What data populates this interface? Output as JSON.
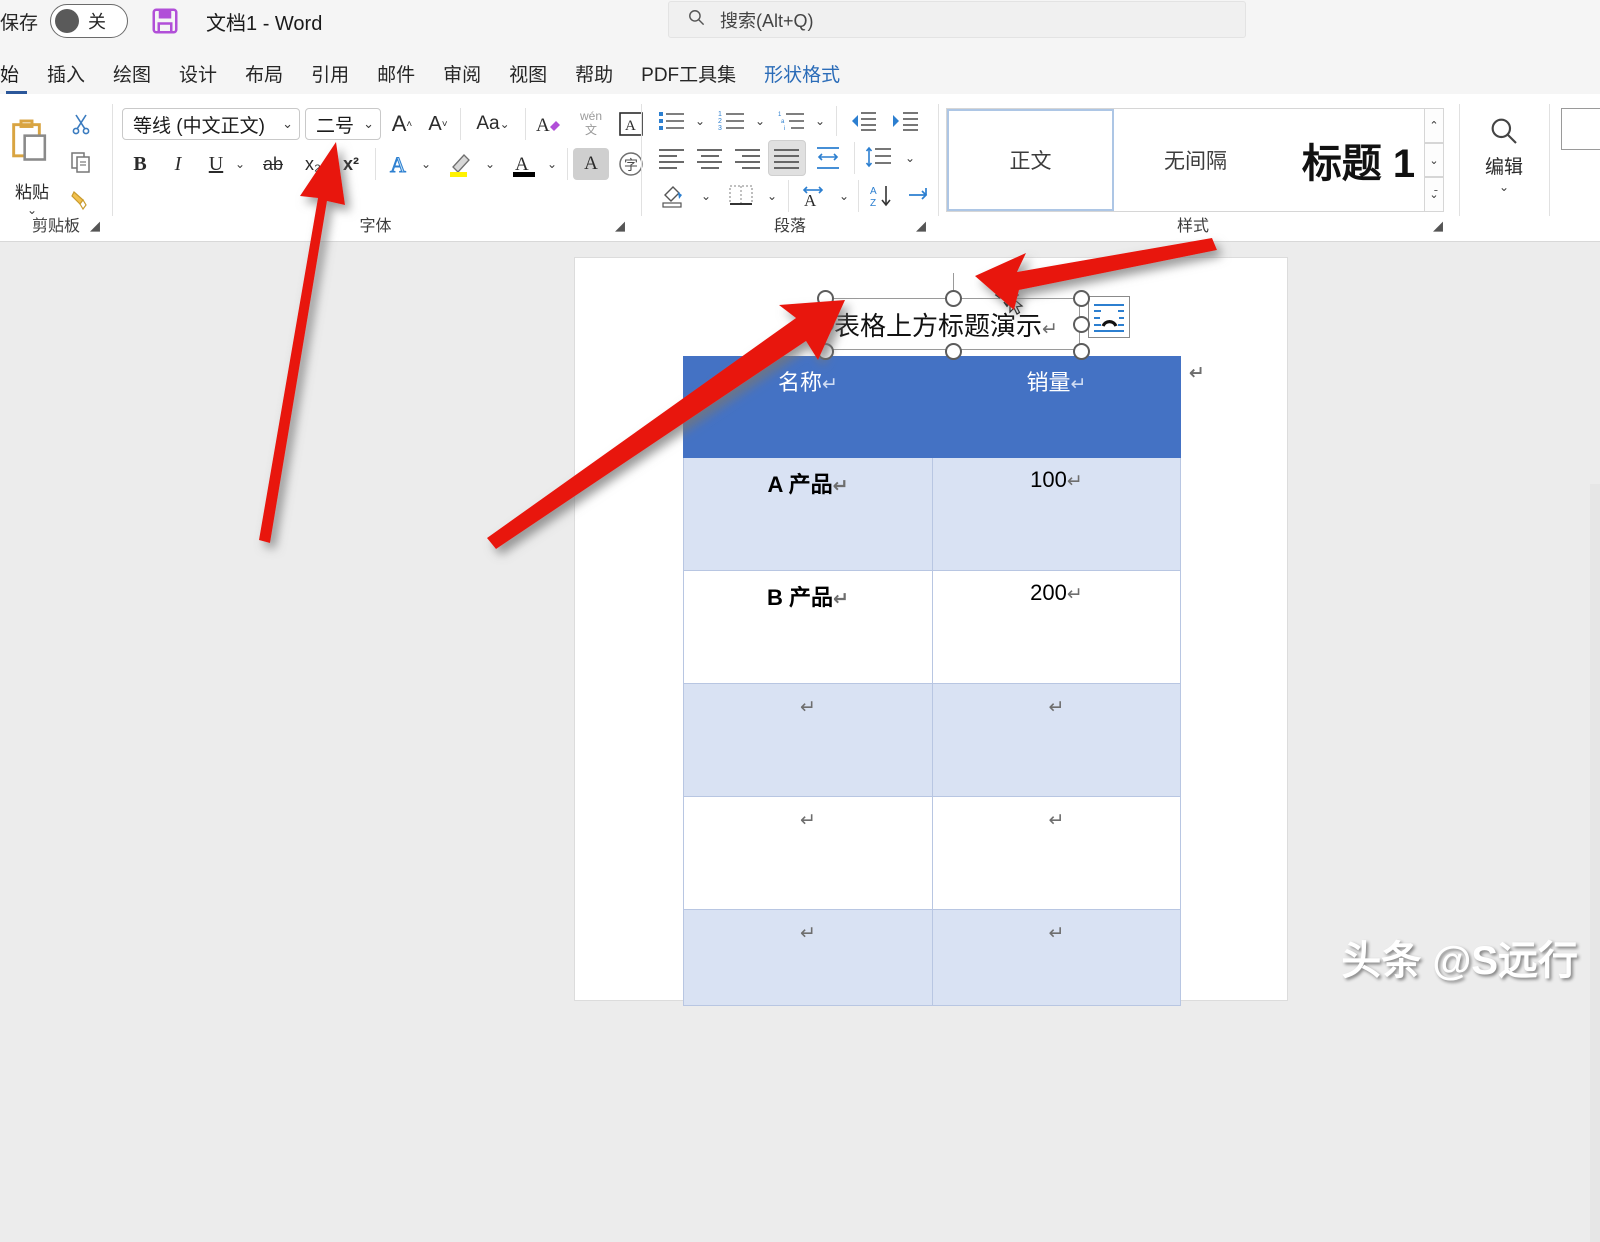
{
  "titlebar": {
    "autosave_label": "保存",
    "autosave_state": "关",
    "save_icon": "floppy-disk-icon",
    "document_title": "文档1  -  Word",
    "search_icon": "search-icon",
    "search_placeholder": "搜索(Alt+Q)"
  },
  "tabs": [
    {
      "label": "始",
      "state": "active"
    },
    {
      "label": "插入",
      "state": "normal"
    },
    {
      "label": "绘图",
      "state": "normal"
    },
    {
      "label": "设计",
      "state": "normal"
    },
    {
      "label": "布局",
      "state": "normal"
    },
    {
      "label": "引用",
      "state": "normal"
    },
    {
      "label": "邮件",
      "state": "normal"
    },
    {
      "label": "审阅",
      "state": "normal"
    },
    {
      "label": "视图",
      "state": "normal"
    },
    {
      "label": "帮助",
      "state": "normal"
    },
    {
      "label": "PDF工具集",
      "state": "normal"
    },
    {
      "label": "形状格式",
      "state": "contextual"
    }
  ],
  "ribbon": {
    "clipboard": {
      "label": "剪贴板",
      "paste_label": "粘贴",
      "paste_icon": "clipboard-icon",
      "cut_icon": "scissors-icon",
      "copy_icon": "copy-icon",
      "format_painter_icon": "format-painter-icon",
      "launcher_icon": "dialog-launcher-icon"
    },
    "font": {
      "label": "字体",
      "font_name": "等线 (中文正文)",
      "font_size": "二号",
      "grow_font_icon": "grow-font-icon",
      "shrink_font_icon": "shrink-font-icon",
      "change_case_icon": "change-case-icon",
      "clear_formatting_icon": "clear-formatting-icon",
      "phonetic_guide_icon": "phonetic-guide-icon",
      "character_border_icon": "character-border-icon",
      "bold_label": "B",
      "italic_label": "I",
      "underline_label": "U",
      "strikethrough_label": "ab",
      "subscript_label": "x₂",
      "superscript_label": "x²",
      "text_effects_icon": "text-effects-icon",
      "highlight_icon": "text-highlight-icon",
      "font_color_icon": "font-color-icon",
      "character_shading_icon": "character-shading-icon",
      "enclose_characters_icon": "enclose-characters-icon",
      "launcher_icon": "dialog-launcher-icon"
    },
    "paragraph": {
      "label": "段落",
      "bullets_icon": "bullet-list-icon",
      "numbering_icon": "numbered-list-icon",
      "multilevel_icon": "multilevel-list-icon",
      "decrease_indent_icon": "decrease-indent-icon",
      "increase_indent_icon": "increase-indent-icon",
      "align_left_icon": "align-left-icon",
      "align_center_icon": "align-center-icon",
      "align_right_icon": "align-right-icon",
      "justify_icon": "justify-icon",
      "distribute_icon": "distribute-text-icon",
      "line_spacing_icon": "line-spacing-icon",
      "shading_icon": "shading-icon",
      "borders_icon": "borders-icon",
      "asian_layout_icon": "asian-layout-icon",
      "sort_icon": "sort-icon",
      "show_marks_icon": "show-formatting-marks-icon",
      "launcher_icon": "dialog-launcher-icon"
    },
    "styles": {
      "label": "样式",
      "items": [
        {
          "name": "正文",
          "selected": true
        },
        {
          "name": "无间隔",
          "selected": false
        },
        {
          "name": "标题 1",
          "selected": false
        }
      ],
      "scroll_up_icon": "chevron-up-icon",
      "scroll_down_icon": "chevron-down-icon",
      "more_icon": "more-styles-icon",
      "launcher_icon": "dialog-launcher-icon"
    },
    "editing": {
      "label": "编辑",
      "icon": "magnifier-icon",
      "chevron_icon": "chevron-down-icon"
    }
  },
  "document": {
    "textbox": {
      "text": "表格上方标题演示",
      "paragraph_mark": "↵",
      "selected": true,
      "handle_icon": "resize-handle-icon",
      "rotate_icon": "rotation-bar-icon",
      "move_cursor_icon": "move-cursor-icon",
      "layout_options_icon": "layout-options-icon"
    },
    "table": {
      "header_bg": "#4472C4",
      "band_bg": "#D9E2F3",
      "border_color": "#B8C6E2",
      "headers": [
        "名称",
        "销量"
      ],
      "rows": [
        {
          "cells": [
            "A 产品",
            "100"
          ],
          "banded": true
        },
        {
          "cells": [
            "B 产品",
            "200"
          ],
          "banded": false
        },
        {
          "cells": [
            "",
            ""
          ],
          "banded": true
        },
        {
          "cells": [
            "",
            ""
          ],
          "banded": false
        },
        {
          "cells": [
            "",
            ""
          ],
          "banded": true
        }
      ],
      "paragraph_mark": "↵",
      "row_end_mark": "↵"
    }
  },
  "watermark": "头条 @S远行",
  "annotations": {
    "arrow_color": "#E8160C",
    "arrows": [
      {
        "name": "arrow-to-font-size",
        "points_to": "font_size_combo"
      },
      {
        "name": "arrow-to-textbox",
        "points_to": "textbox_move_cursor"
      },
      {
        "name": "arrow-to-textbox-left",
        "points_to": "textbox_left_handle"
      }
    ]
  }
}
